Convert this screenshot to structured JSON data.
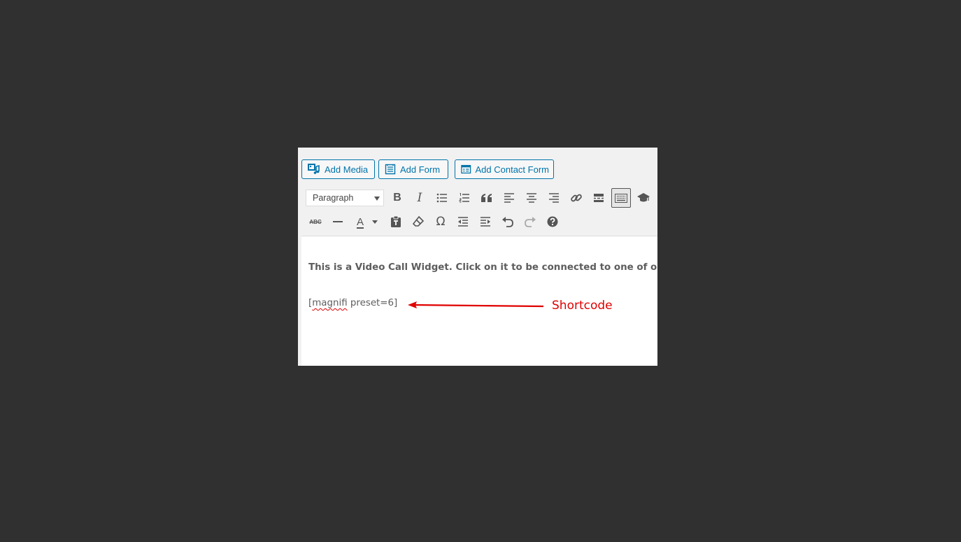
{
  "media_buttons": {
    "add_media": "Add Media",
    "add_form": "Add Form",
    "add_contact_form": "Add Contact Form"
  },
  "toolbar": {
    "format_select": "Paragraph",
    "strikethrough_label": "ABC",
    "row1_icons": [
      "bold-icon",
      "italic-icon",
      "bulleted-list-icon",
      "numbered-list-icon",
      "blockquote-icon",
      "align-left-icon",
      "align-center-icon",
      "align-right-icon",
      "link-icon",
      "read-more-icon",
      "toolbar-toggle-icon",
      "graduation-cap-icon"
    ],
    "row2_icons": [
      "strikethrough-icon",
      "horizontal-line-icon",
      "text-color-icon",
      "paste-as-text-icon",
      "clear-formatting-icon",
      "special-character-icon",
      "outdent-icon",
      "indent-icon",
      "undo-icon",
      "redo-icon",
      "help-icon"
    ]
  },
  "content": {
    "paragraph": "This is a Video Call Widget. Click on it to be connected to one of our staff.",
    "shortcode_word": "magnifi",
    "shortcode_prefix": "[",
    "shortcode_suffix": " preset=6]"
  },
  "annotation": {
    "label": "Shortcode",
    "color": "#e00000"
  },
  "colors": {
    "background": "#303030",
    "accent": "#0073aa"
  }
}
